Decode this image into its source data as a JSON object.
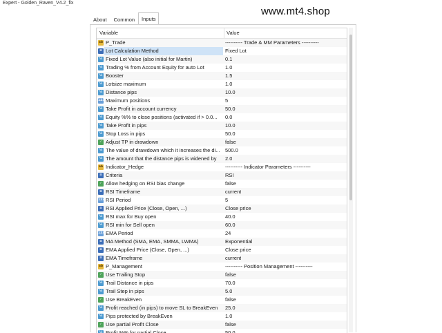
{
  "window": {
    "title": "Expert - Golden_Raven_V4.2_fix",
    "watermark": "www.mt4.shop"
  },
  "tabs": [
    {
      "label": "About",
      "active": false
    },
    {
      "label": "Common",
      "active": false
    },
    {
      "label": "Inputs",
      "active": true
    }
  ],
  "grid": {
    "headers": {
      "variable": "Variable",
      "value": "Value"
    },
    "rows": [
      {
        "icon": "string-icon",
        "name": "P_Trade",
        "value": "---------- Trade & MM Parameters ----------"
      },
      {
        "icon": "enum-icon",
        "name": "Lot Calculation Method",
        "value": "Fixed Lot",
        "selected": true
      },
      {
        "icon": "double-icon",
        "name": "Fixed Lot Value (also initial for Martin)",
        "value": "0.1"
      },
      {
        "icon": "double-icon",
        "name": "Trading % from Account Equity for auto Lot",
        "value": "1.0"
      },
      {
        "icon": "double-icon",
        "name": "Booster",
        "value": "1.5"
      },
      {
        "icon": "double-icon",
        "name": "Lotsize maximum",
        "value": "1.0"
      },
      {
        "icon": "double-icon",
        "name": "Distance pips",
        "value": "10.0"
      },
      {
        "icon": "integer-icon",
        "name": "Maximum positions",
        "value": "5"
      },
      {
        "icon": "double-icon",
        "name": "Take Profit in account currency",
        "value": "50.0"
      },
      {
        "icon": "double-icon",
        "name": "Equity %% to close positions (activated if > 0.0...",
        "value": "0.0"
      },
      {
        "icon": "double-icon",
        "name": "Take Profit in pips",
        "value": "10.0"
      },
      {
        "icon": "double-icon",
        "name": "Stop Loss in pips",
        "value": "50.0"
      },
      {
        "icon": "bool-icon",
        "name": "Adjust TP in drawdown",
        "value": "false"
      },
      {
        "icon": "double-icon",
        "name": "The value of drawdown which it increases the di...",
        "value": "500.0"
      },
      {
        "icon": "double-icon",
        "name": "The amount that the distance pips is widened by",
        "value": "2.0"
      },
      {
        "icon": "string-icon",
        "name": "Indicator_Hedge",
        "value": "---------- Indicator Parameters ----------"
      },
      {
        "icon": "enum-icon",
        "name": "Criteria",
        "value": "RSI"
      },
      {
        "icon": "bool-icon",
        "name": "Allow hedging on RSI bias change",
        "value": "false"
      },
      {
        "icon": "enum-icon",
        "name": "RSI Timeframe",
        "value": "current"
      },
      {
        "icon": "integer-icon",
        "name": "RSI Period",
        "value": "5"
      },
      {
        "icon": "enum-icon",
        "name": "RSI Applied Price (Close, Open, ...)",
        "value": "Close price"
      },
      {
        "icon": "double-icon",
        "name": "RSI max for Buy open",
        "value": "40.0"
      },
      {
        "icon": "double-icon",
        "name": "RSI min for Sell open",
        "value": "60.0"
      },
      {
        "icon": "integer-icon",
        "name": "EMA Period",
        "value": "24"
      },
      {
        "icon": "enum-icon",
        "name": "MA Method (SMA, EMA, SMMA, LWMA)",
        "value": "Exponential"
      },
      {
        "icon": "enum-icon",
        "name": "EMA Applied Price (Close, Open, ...)",
        "value": "Close price"
      },
      {
        "icon": "enum-icon",
        "name": "EMA Timeframe",
        "value": "current"
      },
      {
        "icon": "string-icon",
        "name": "P_Management",
        "value": "---------- Position Management ----------"
      },
      {
        "icon": "bool-icon",
        "name": "Use Trailing Stop",
        "value": "false"
      },
      {
        "icon": "double-icon",
        "name": "Trail Distance in pips",
        "value": "70.0"
      },
      {
        "icon": "double-icon",
        "name": "Trail Step in pips",
        "value": "5.0"
      },
      {
        "icon": "bool-icon",
        "name": "Use BreakEven",
        "value": "false"
      },
      {
        "icon": "double-icon",
        "name": "Profit reached (in pips) to move SL to BreakEven",
        "value": "25.0"
      },
      {
        "icon": "double-icon",
        "name": "Pips protected by BreakEven",
        "value": "1.0"
      },
      {
        "icon": "bool-icon",
        "name": "Use partial Profit Close",
        "value": "false"
      },
      {
        "icon": "double-icon",
        "name": "Profit %% for partial Close",
        "value": "50.0"
      }
    ]
  }
}
